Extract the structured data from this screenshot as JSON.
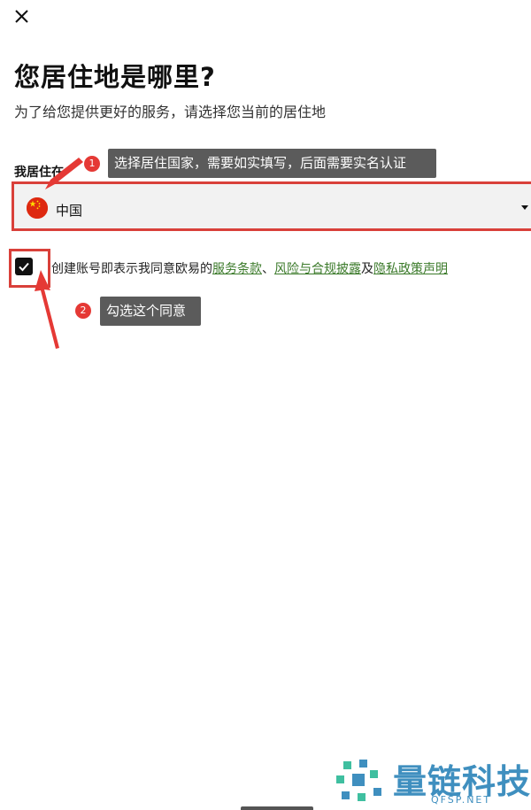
{
  "header": {
    "close_label": "close"
  },
  "page": {
    "title": "您居住地是哪里?",
    "subtitle": "为了给您提供更好的服务，请选择您当前的居住地"
  },
  "country": {
    "label": "我居住在",
    "selected": "中国",
    "flag_icon": "china-flag-icon"
  },
  "agreement": {
    "checked": true,
    "prefix": "创建账号即表示我同意欧易的",
    "link_terms": "服务条款",
    "separator": "、",
    "link_risk": "风险与合规披露",
    "conjunction": "及",
    "link_privacy": "隐私政策声明"
  },
  "annotations": {
    "step1_number": "1",
    "step1_text": "选择居住国家，需要如实填写，后面需要实名认证",
    "step2_number": "2",
    "step2_text": "勾选这个同意",
    "highlight_color": "#d9403a"
  },
  "watermark": {
    "title": "量链科技",
    "domain": "QFSP.NET"
  },
  "colors": {
    "link": "#3b7a2a",
    "tooltip_bg": "#5b5b5b",
    "badge": "#e53935"
  }
}
